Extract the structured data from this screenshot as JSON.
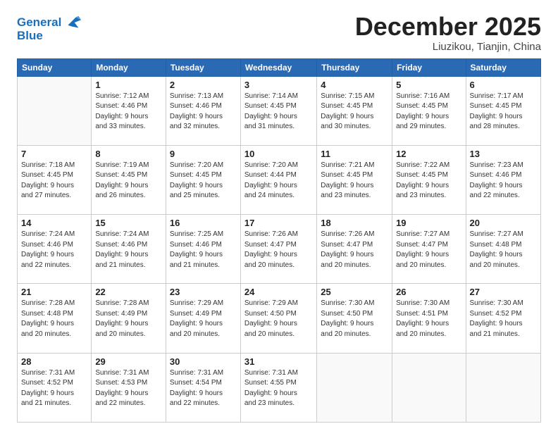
{
  "logo": {
    "line1": "General",
    "line2": "Blue"
  },
  "header": {
    "month": "December 2025",
    "location": "Liuzikou, Tianjin, China"
  },
  "weekdays": [
    "Sunday",
    "Monday",
    "Tuesday",
    "Wednesday",
    "Thursday",
    "Friday",
    "Saturday"
  ],
  "weeks": [
    [
      {
        "day": "",
        "info": ""
      },
      {
        "day": "1",
        "info": "Sunrise: 7:12 AM\nSunset: 4:46 PM\nDaylight: 9 hours\nand 33 minutes."
      },
      {
        "day": "2",
        "info": "Sunrise: 7:13 AM\nSunset: 4:46 PM\nDaylight: 9 hours\nand 32 minutes."
      },
      {
        "day": "3",
        "info": "Sunrise: 7:14 AM\nSunset: 4:45 PM\nDaylight: 9 hours\nand 31 minutes."
      },
      {
        "day": "4",
        "info": "Sunrise: 7:15 AM\nSunset: 4:45 PM\nDaylight: 9 hours\nand 30 minutes."
      },
      {
        "day": "5",
        "info": "Sunrise: 7:16 AM\nSunset: 4:45 PM\nDaylight: 9 hours\nand 29 minutes."
      },
      {
        "day": "6",
        "info": "Sunrise: 7:17 AM\nSunset: 4:45 PM\nDaylight: 9 hours\nand 28 minutes."
      }
    ],
    [
      {
        "day": "7",
        "info": "Sunrise: 7:18 AM\nSunset: 4:45 PM\nDaylight: 9 hours\nand 27 minutes."
      },
      {
        "day": "8",
        "info": "Sunrise: 7:19 AM\nSunset: 4:45 PM\nDaylight: 9 hours\nand 26 minutes."
      },
      {
        "day": "9",
        "info": "Sunrise: 7:20 AM\nSunset: 4:45 PM\nDaylight: 9 hours\nand 25 minutes."
      },
      {
        "day": "10",
        "info": "Sunrise: 7:20 AM\nSunset: 4:44 PM\nDaylight: 9 hours\nand 24 minutes."
      },
      {
        "day": "11",
        "info": "Sunrise: 7:21 AM\nSunset: 4:45 PM\nDaylight: 9 hours\nand 23 minutes."
      },
      {
        "day": "12",
        "info": "Sunrise: 7:22 AM\nSunset: 4:45 PM\nDaylight: 9 hours\nand 23 minutes."
      },
      {
        "day": "13",
        "info": "Sunrise: 7:23 AM\nSunset: 4:46 PM\nDaylight: 9 hours\nand 22 minutes."
      }
    ],
    [
      {
        "day": "14",
        "info": "Sunrise: 7:24 AM\nSunset: 4:46 PM\nDaylight: 9 hours\nand 22 minutes."
      },
      {
        "day": "15",
        "info": "Sunrise: 7:24 AM\nSunset: 4:46 PM\nDaylight: 9 hours\nand 21 minutes."
      },
      {
        "day": "16",
        "info": "Sunrise: 7:25 AM\nSunset: 4:46 PM\nDaylight: 9 hours\nand 21 minutes."
      },
      {
        "day": "17",
        "info": "Sunrise: 7:26 AM\nSunset: 4:47 PM\nDaylight: 9 hours\nand 20 minutes."
      },
      {
        "day": "18",
        "info": "Sunrise: 7:26 AM\nSunset: 4:47 PM\nDaylight: 9 hours\nand 20 minutes."
      },
      {
        "day": "19",
        "info": "Sunrise: 7:27 AM\nSunset: 4:47 PM\nDaylight: 9 hours\nand 20 minutes."
      },
      {
        "day": "20",
        "info": "Sunrise: 7:27 AM\nSunset: 4:48 PM\nDaylight: 9 hours\nand 20 minutes."
      }
    ],
    [
      {
        "day": "21",
        "info": "Sunrise: 7:28 AM\nSunset: 4:48 PM\nDaylight: 9 hours\nand 20 minutes."
      },
      {
        "day": "22",
        "info": "Sunrise: 7:28 AM\nSunset: 4:49 PM\nDaylight: 9 hours\nand 20 minutes."
      },
      {
        "day": "23",
        "info": "Sunrise: 7:29 AM\nSunset: 4:49 PM\nDaylight: 9 hours\nand 20 minutes."
      },
      {
        "day": "24",
        "info": "Sunrise: 7:29 AM\nSunset: 4:50 PM\nDaylight: 9 hours\nand 20 minutes."
      },
      {
        "day": "25",
        "info": "Sunrise: 7:30 AM\nSunset: 4:50 PM\nDaylight: 9 hours\nand 20 minutes."
      },
      {
        "day": "26",
        "info": "Sunrise: 7:30 AM\nSunset: 4:51 PM\nDaylight: 9 hours\nand 20 minutes."
      },
      {
        "day": "27",
        "info": "Sunrise: 7:30 AM\nSunset: 4:52 PM\nDaylight: 9 hours\nand 21 minutes."
      }
    ],
    [
      {
        "day": "28",
        "info": "Sunrise: 7:31 AM\nSunset: 4:52 PM\nDaylight: 9 hours\nand 21 minutes."
      },
      {
        "day": "29",
        "info": "Sunrise: 7:31 AM\nSunset: 4:53 PM\nDaylight: 9 hours\nand 22 minutes."
      },
      {
        "day": "30",
        "info": "Sunrise: 7:31 AM\nSunset: 4:54 PM\nDaylight: 9 hours\nand 22 minutes."
      },
      {
        "day": "31",
        "info": "Sunrise: 7:31 AM\nSunset: 4:55 PM\nDaylight: 9 hours\nand 23 minutes."
      },
      {
        "day": "",
        "info": ""
      },
      {
        "day": "",
        "info": ""
      },
      {
        "day": "",
        "info": ""
      }
    ]
  ]
}
